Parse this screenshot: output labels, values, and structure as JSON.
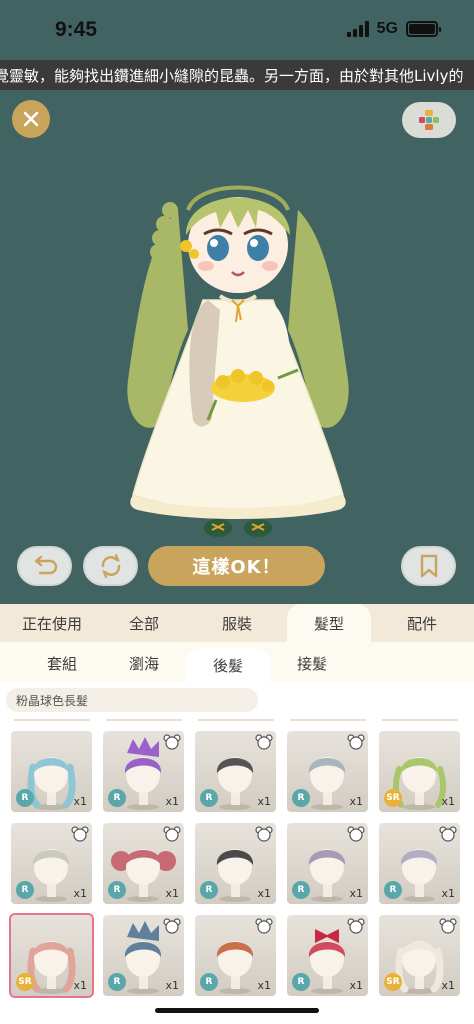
{
  "status": {
    "time": "9:45",
    "network": "5G"
  },
  "ticker": {
    "text": "覺靈敏，能夠找出鑽進細小縫隙的昆蟲。另一方面，由於對其他Livly的"
  },
  "actions": {
    "ok_label": "這樣OK！"
  },
  "category_tabs": [
    {
      "label": "正在使用",
      "active": false
    },
    {
      "label": "全部",
      "active": false
    },
    {
      "label": "服裝",
      "active": false
    },
    {
      "label": "髮型",
      "active": true
    },
    {
      "label": "配件",
      "active": false
    }
  ],
  "sub_tabs": [
    {
      "label": "套組",
      "active": false
    },
    {
      "label": "瀏海",
      "active": false
    },
    {
      "label": "後髮",
      "active": true
    },
    {
      "label": "接髮",
      "active": false
    }
  ],
  "selected_item_name": "粉晶球色長髮",
  "items": [
    {
      "rarity": "R",
      "count": "x1",
      "hair_color": "#8fc6d6",
      "style": "tail",
      "badge": false,
      "selected": false
    },
    {
      "rarity": "R",
      "count": "x1",
      "hair_color": "#9a62c9",
      "style": "spiky",
      "badge": true,
      "selected": false
    },
    {
      "rarity": "R",
      "count": "x1",
      "hair_color": "#555555",
      "style": "short",
      "badge": true,
      "selected": false
    },
    {
      "rarity": "R",
      "count": "x1",
      "hair_color": "#a9b4bf",
      "style": "short",
      "badge": true,
      "selected": false
    },
    {
      "rarity": "SR",
      "count": "x1",
      "hair_color": "#a9c66a",
      "style": "twin",
      "badge": false,
      "selected": false
    },
    {
      "rarity": "R",
      "count": "x1",
      "hair_color": "#c9cabb",
      "style": "short",
      "badge": true,
      "selected": false
    },
    {
      "rarity": "R",
      "count": "x1",
      "hair_color": "#c86a73",
      "style": "buns",
      "badge": true,
      "selected": false
    },
    {
      "rarity": "R",
      "count": "x1",
      "hair_color": "#4a4a4a",
      "style": "short",
      "badge": true,
      "selected": false
    },
    {
      "rarity": "R",
      "count": "x1",
      "hair_color": "#a89ab5",
      "style": "short",
      "badge": true,
      "selected": false
    },
    {
      "rarity": "R",
      "count": "x1",
      "hair_color": "#b1aec3",
      "style": "short",
      "badge": true,
      "selected": false
    },
    {
      "rarity": "SR",
      "count": "x1",
      "hair_color": "#e0a49a",
      "style": "long",
      "badge": false,
      "selected": true
    },
    {
      "rarity": "R",
      "count": "x1",
      "hair_color": "#5f7f9a",
      "style": "spiky",
      "badge": true,
      "selected": false
    },
    {
      "rarity": "R",
      "count": "x1",
      "hair_color": "#c9704b",
      "style": "short",
      "badge": true,
      "selected": false
    },
    {
      "rarity": "R",
      "count": "x1",
      "hair_color": "#d24a5f",
      "style": "bow",
      "badge": true,
      "selected": false
    },
    {
      "rarity": "SR",
      "count": "x1",
      "hair_color": "#efe8dc",
      "style": "long",
      "badge": true,
      "selected": false
    }
  ],
  "colors": {
    "stage": "#416463",
    "accent": "#c9a45c",
    "rarity_r": "#5aa7a9",
    "rarity_sr": "#e8b23a"
  },
  "icons": {
    "close": "close-icon",
    "palette": "palette-icon",
    "undo": "undo-icon",
    "rotate": "rotate-icon",
    "bookmark": "bookmark-icon"
  }
}
